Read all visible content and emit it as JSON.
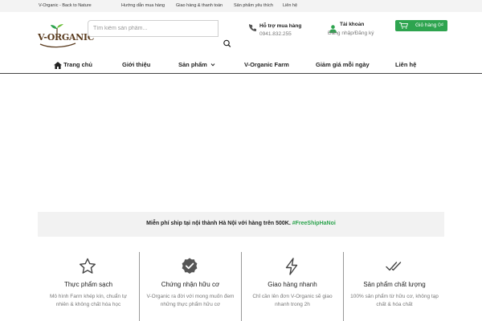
{
  "topbar": {
    "tagline": "V-Organic - Back to Nature",
    "links": [
      "Hướng dẫn mua hàng",
      "Giao hàng & thanh toán",
      "Sản phẩm yêu thích",
      "Liên hệ"
    ]
  },
  "logo": {
    "text": "V-ORGANIC"
  },
  "search": {
    "placeholder": "Tìm kiếm sản phẩm..."
  },
  "support": {
    "title": "Hỗ trợ mua hàng",
    "phone": "0941.832.255"
  },
  "account": {
    "title": "Tài khoản",
    "subtitle": "Đăng nhập/Đăng ký"
  },
  "cart": {
    "label": "Giỏ hàng 0₫"
  },
  "nav": {
    "home": "Trang chủ",
    "about": "Giới thiệu",
    "products": "Sản phẩm",
    "farm": "V-Organic Farm",
    "sale": "Giảm giá mỗi ngày",
    "contact": "Liên hệ"
  },
  "banner": {
    "text": "Miễn phí ship tại nội thành Hà Nội với hàng trên 500K.",
    "hashtag": "#FreeShipHaNoi"
  },
  "features": [
    {
      "title": "Thực phẩm sạch",
      "desc": "Mô hình Farm khép kín, chuẩn tự nhiên & không chất hóa học",
      "icon": "star-icon"
    },
    {
      "title": "Chứng nhận hữu cơ",
      "desc": "V-Organic ra đời với mong muốn đem những thực phẩm hữu cơ",
      "icon": "verified-badge-icon"
    },
    {
      "title": "Giao hàng nhanh",
      "desc": "Chỉ cần lên đơn V-Organic sẽ giao nhanh trong 2h",
      "icon": "lightning-icon"
    },
    {
      "title": "Sản phẩm chất lượng",
      "desc": "100% sản phẩm từ hữu cơ, không tạp chất & hóa chất",
      "icon": "double-check-icon"
    }
  ],
  "colors": {
    "accent": "#2ea44f",
    "brand": "#5a3b1e"
  }
}
